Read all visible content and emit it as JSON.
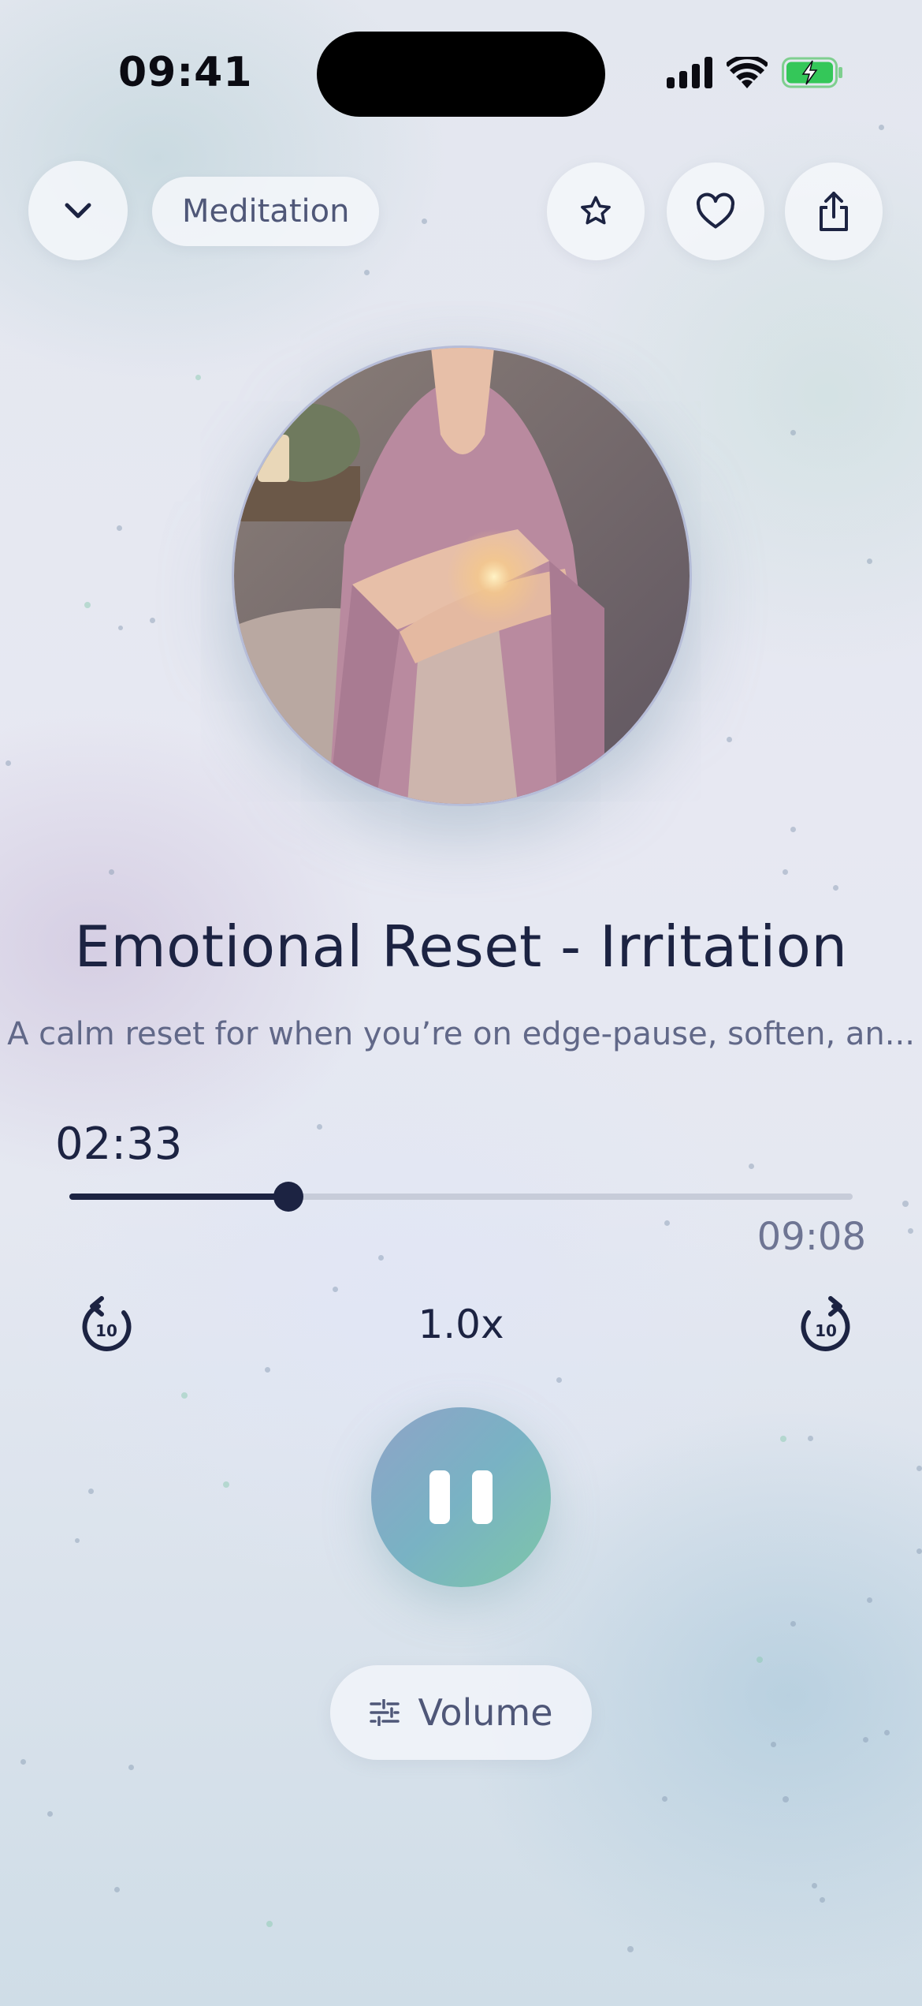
{
  "status_bar": {
    "time": "09:41"
  },
  "header": {
    "category": "Meditation",
    "icons": [
      "chevron-down-icon",
      "star-icon",
      "heart-icon",
      "share-icon"
    ]
  },
  "track": {
    "title": "Emotional Reset - Irritation",
    "description": "A calm reset for when you’re on edge-pause, soften, an...",
    "elapsed": "02:33",
    "duration": "09:08",
    "progress_fraction": 0.28
  },
  "controls": {
    "rewind_seconds": "10",
    "forward_seconds": "10",
    "speed": "1.0x",
    "state": "playing",
    "volume_label": "Volume"
  },
  "colors": {
    "text_primary": "#1c2342",
    "play_gradient_start": "#8fa3c7",
    "play_gradient_end": "#7dc6a8",
    "battery_fill": "#34c759"
  }
}
